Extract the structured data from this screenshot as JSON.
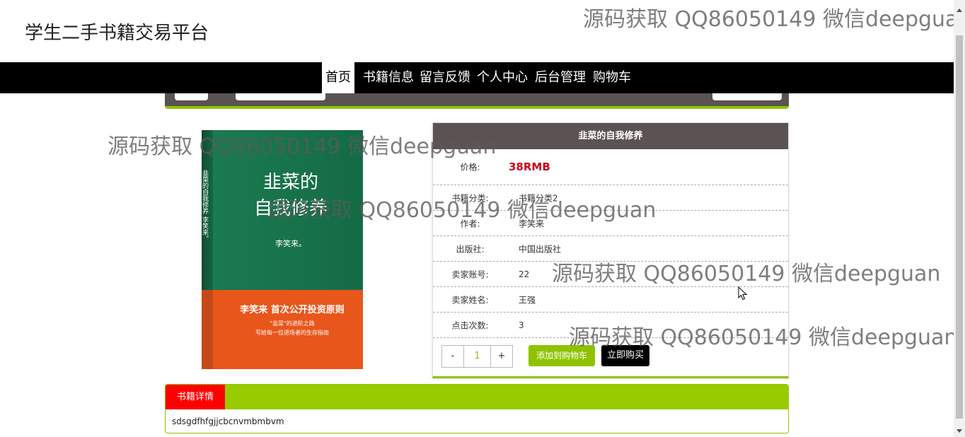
{
  "site": {
    "title": "学生二手书籍交易平台"
  },
  "nav": {
    "items": [
      {
        "label": "首页"
      },
      {
        "label": "书籍信息"
      },
      {
        "label": "留言反馈"
      },
      {
        "label": "个人中心"
      },
      {
        "label": "后台管理"
      },
      {
        "label": "购物车"
      }
    ]
  },
  "cover": {
    "title_line1": "韭菜的",
    "title_line2": "自我修养",
    "author": "李笑来。",
    "spine": "韭菜的自我修养 李笑来。",
    "band_title": "李笑来 首次公开投资原则",
    "band_sub1": "\"韭菜\"的进阶之路",
    "band_sub2": "写给每一位进场者的生存指南"
  },
  "book": {
    "title": "韭菜的自我修养",
    "fields": [
      {
        "label": "价格:",
        "value": "38RMB"
      },
      {
        "label": "书籍分类:",
        "value": "书籍分类2"
      },
      {
        "label": "作者:",
        "value": "李笑来"
      },
      {
        "label": "出版社:",
        "value": "中国出版社"
      },
      {
        "label": "卖家账号:",
        "value": "22"
      },
      {
        "label": "卖家姓名:",
        "value": "王强"
      },
      {
        "label": "点击次数:",
        "value": "3"
      }
    ]
  },
  "purchase": {
    "minus": "-",
    "quantity": "1",
    "plus": "+",
    "add_to_cart": "添加到购物车",
    "buy_now": "立即购买"
  },
  "detail": {
    "tab": "书籍详情",
    "content": "sdsgdfhfgjjcbcnvmbmbvm"
  },
  "watermark": {
    "text": "源码获取 QQ86050149 微信deepguan"
  },
  "colors": {
    "accent_green": "#99cc00",
    "header_dark": "#5b5352",
    "price_red": "#d0021b",
    "tab_red": "#ff0000"
  }
}
